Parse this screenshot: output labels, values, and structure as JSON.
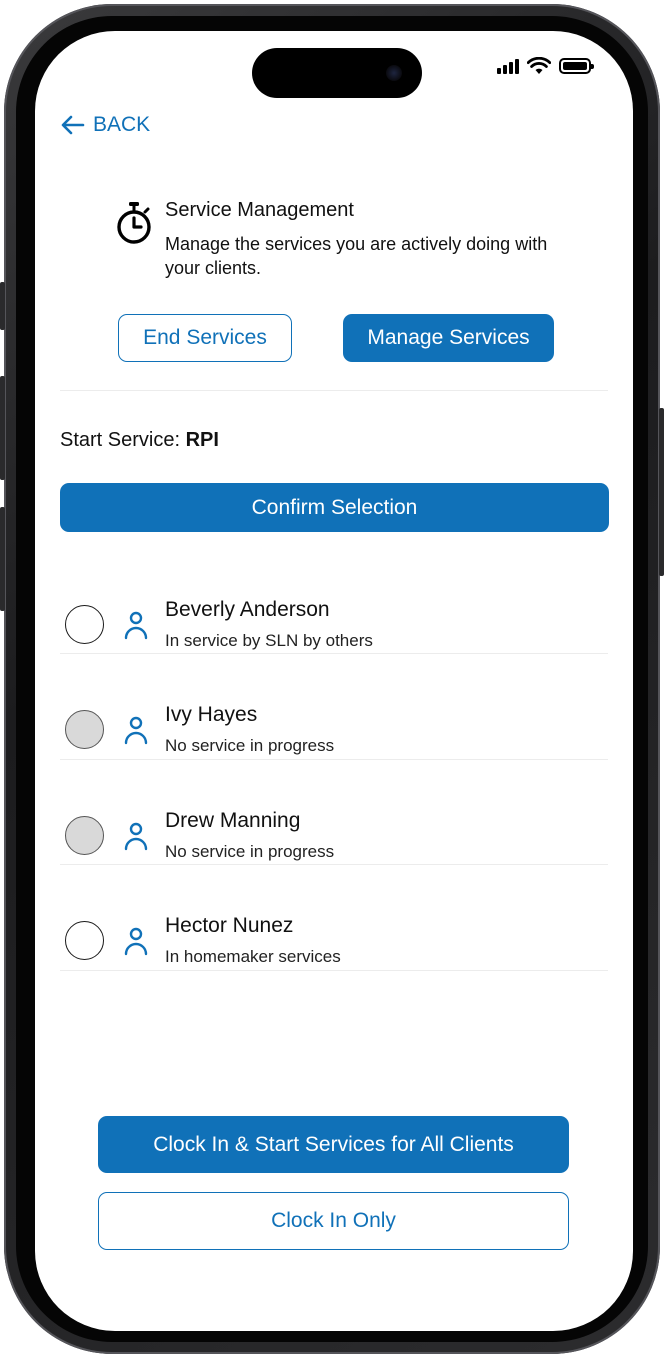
{
  "nav": {
    "back_label": "BACK"
  },
  "header": {
    "title": "Service Management",
    "description": "Manage the services you are actively doing with your clients."
  },
  "actions": {
    "end_services": "End Services",
    "manage_services": "Manage Services"
  },
  "start_service": {
    "label": "Start Service:",
    "value": "RPI"
  },
  "confirm_label": "Confirm Selection",
  "clients": [
    {
      "name": "Beverly Anderson",
      "status": "In service by SLN by others",
      "selectable": true
    },
    {
      "name": "Ivy Hayes",
      "status": "No service in progress",
      "selectable": false
    },
    {
      "name": "Drew Manning",
      "status": "No service in progress",
      "selectable": false
    },
    {
      "name": "Hector Nunez",
      "status": "In homemaker services",
      "selectable": true
    }
  ],
  "footer": {
    "clock_in_all": "Clock In & Start Services for All Clients",
    "clock_in_only": "Clock In Only"
  },
  "colors": {
    "accent": "#1071b8",
    "disabled_radio": "#d9d9d9"
  },
  "icons": [
    "back-arrow-icon",
    "timer-icon",
    "person-icon",
    "signal-icon",
    "wifi-icon",
    "battery-icon"
  ]
}
